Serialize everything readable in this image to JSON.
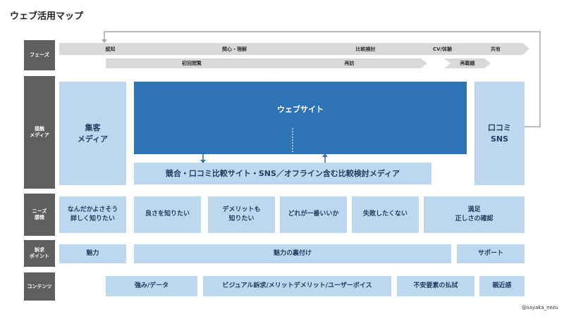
{
  "title": "ウェブ活用マップ",
  "row_labels": {
    "phase": "フェーズ",
    "media": "接触\nメディア",
    "needs": "ニーズ\n感情",
    "appeal": "訴求\nポイント",
    "contents": "コンテンツ"
  },
  "phases_top": [
    "認知",
    "関心・理解",
    "比較検討",
    "CV/体験",
    "共有"
  ],
  "phases_bottom": [
    "初回閲覧",
    "再訪",
    "再載縫"
  ],
  "media": {
    "shuukyaku": "集客\nメディア",
    "website": "ウェブサイト",
    "kuchikomi": "口コミ\nSNS",
    "compare": "競合・口コミ比較サイト・SNS／オフライン含む比較検討メディア"
  },
  "needs": [
    "なんだかよさそう\n詳しく知りたい",
    "良さを知りたい",
    "デメリットも\n知りたい",
    "どれが一番いいか",
    "失敗したくない",
    "満足\n正しさの確認"
  ],
  "appeal": [
    "魅力",
    "魅力の裏付け",
    "サポート"
  ],
  "contents": [
    "強み/データ",
    "ビジュアル訴求/メリットデメリット/ユーザーボイス",
    "不安要素の払拭",
    "親近感"
  ],
  "credit": "@sayaka_nezu",
  "colors": {
    "label_bg": "#5f5f5f",
    "chevron": "#d9d9d9",
    "light_box": "#bdd7ee",
    "dark_box": "#2e74b5",
    "arrow": "#2e74b5",
    "loop_line": "#a6a6a6"
  }
}
